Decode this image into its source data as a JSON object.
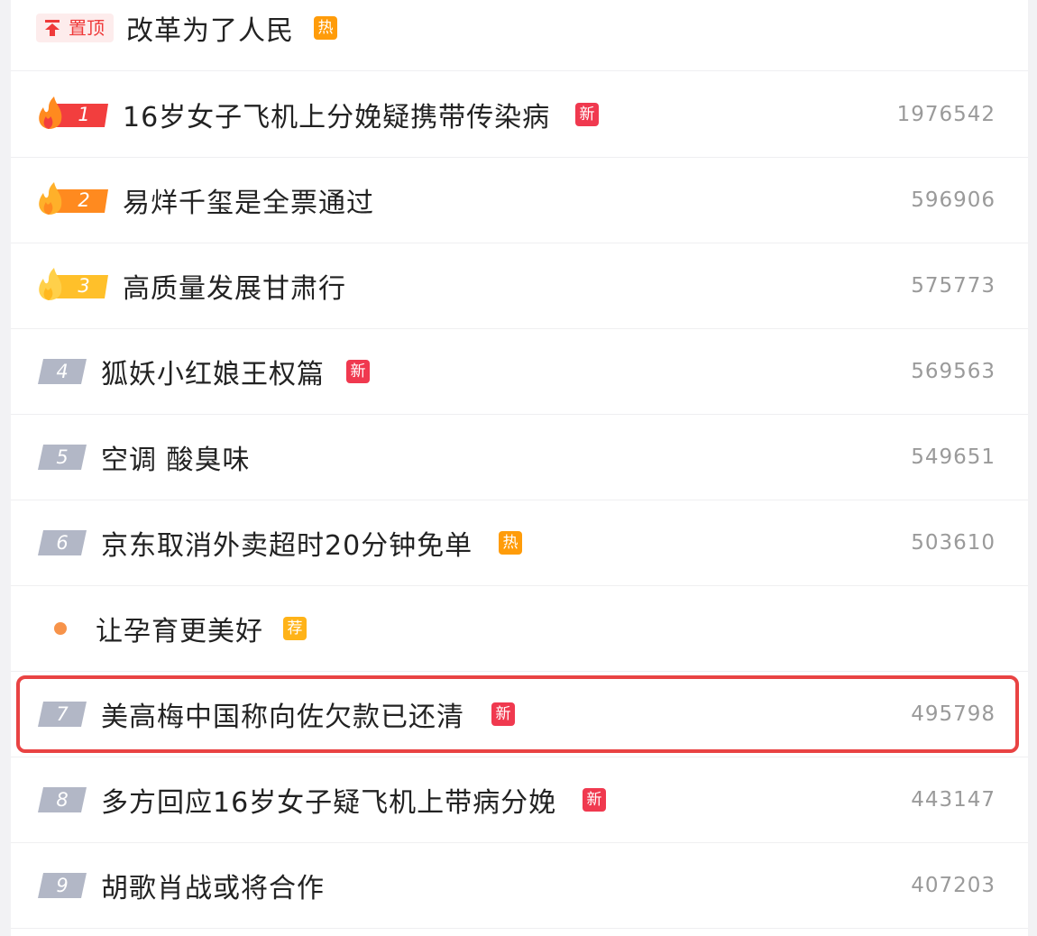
{
  "pinned": {
    "badge_label": "置顶",
    "title": "改革为了人民",
    "tag": "热"
  },
  "items": [
    {
      "rank": "1",
      "title": "16岁女子飞机上分娩疑携带传染病",
      "tag": "新",
      "count": "1976542"
    },
    {
      "rank": "2",
      "title": "易烊千玺是全票通过",
      "tag": "",
      "count": "596906"
    },
    {
      "rank": "3",
      "title": "高质量发展甘肃行",
      "tag": "",
      "count": "575773"
    },
    {
      "rank": "4",
      "title": "狐妖小红娘王权篇",
      "tag": "新",
      "count": "569563"
    },
    {
      "rank": "5",
      "title": "空调 酸臭味",
      "tag": "",
      "count": "549651"
    },
    {
      "rank": "6",
      "title": "京东取消外卖超时20分钟免单",
      "tag": "热",
      "count": "503610"
    },
    {
      "rank": "",
      "title": "让孕育更美好",
      "tag": "荐",
      "count": ""
    },
    {
      "rank": "7",
      "title": "美高梅中国称向佐欠款已还清",
      "tag": "新",
      "count": "495798"
    },
    {
      "rank": "8",
      "title": "多方回应16岁女子疑飞机上带病分娩",
      "tag": "新",
      "count": "443147"
    },
    {
      "rank": "9",
      "title": "胡歌肖战或将合作",
      "tag": "",
      "count": "407203"
    }
  ],
  "colors": {
    "new_tag": "#f0394f",
    "hot_tag": "#ff9c0a",
    "recommend_tag": "#ffb318",
    "rank1": "#f23e3e",
    "rank2": "#ff8a1f",
    "rank3": "#ffc02a",
    "rank_default": "#b2b7c6",
    "highlight_border": "#e94343"
  },
  "highlighted_item_rank": "7"
}
